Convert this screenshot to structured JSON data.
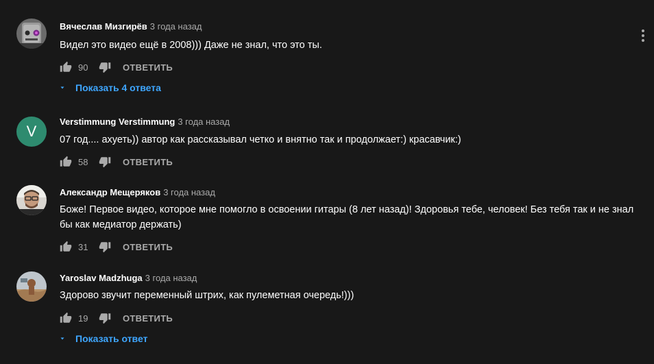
{
  "reply_label": "ОТВЕТИТЬ",
  "comments": [
    {
      "author": "Вячеслав Мизгирёв",
      "time": "3 года назад",
      "text": "Видел это видео ещё в 2008))) Даже не знал, что это ты.",
      "likes": "90",
      "show_replies": "Показать 4 ответа"
    },
    {
      "author": "Verstimmung Verstimmung",
      "time": "3 года назад",
      "avatar_letter": "V",
      "text": "07 год.... ахуеть)) автор как рассказывал четко и внятно так и продолжает:) красавчик:)",
      "likes": "58"
    },
    {
      "author": "Александр Мещеряков",
      "time": "3 года назад",
      "text": "Боже! Первое видео, которое мне помогло в освоении гитары (8 лет назад)! Здоровья тебе, человек! Без тебя так и не знал бы как медиатор держать)",
      "likes": "31"
    },
    {
      "author": "Yaroslav Madzhuga",
      "time": "3 года назад",
      "text": "Здорово звучит переменный штрих, как пулеметная очередь!)))",
      "likes": "19",
      "show_replies": "Показать ответ"
    }
  ],
  "icons": {
    "like": "thumb-up-icon",
    "dislike": "thumb-down-icon",
    "menu": "more-vert-icon",
    "expand": "caret-down-icon"
  },
  "colors": {
    "background": "#181818",
    "link": "#3ea6ff",
    "secondary_text": "#aaaaaa",
    "letter_avatar": "#2e8b6f"
  }
}
